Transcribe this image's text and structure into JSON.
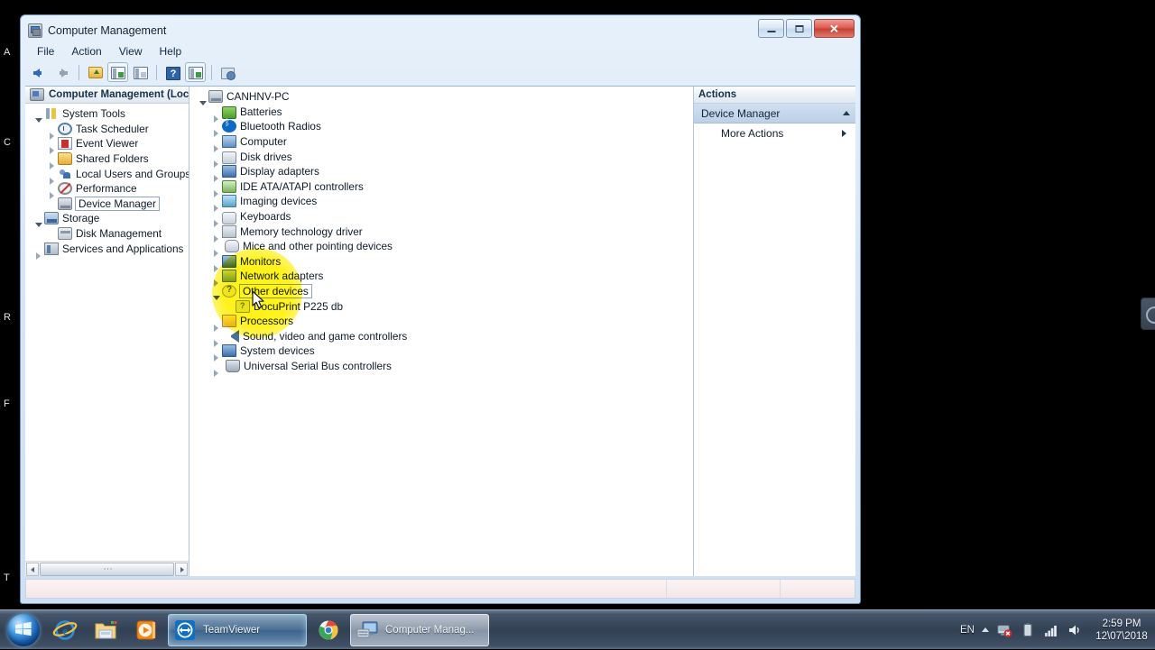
{
  "desktop": {
    "icon_labels": [
      "A",
      "C",
      "R",
      "F",
      "T"
    ],
    "right_widget": "teamviewer-edge-widget"
  },
  "window": {
    "title": "Computer Management",
    "title_icon": "computer-management-icon",
    "buttons": {
      "minimize": "minimize-button",
      "maximize": "maximize-button",
      "close": "close-button",
      "close_glyph": "✕"
    },
    "menus": [
      "File",
      "Action",
      "View",
      "Help"
    ],
    "toolbar": [
      {
        "name": "back-button",
        "icon": "arrow-left-icon"
      },
      {
        "name": "forward-button",
        "icon": "arrow-right-icon"
      },
      {
        "name": "up-one-level-button",
        "icon": "folder-up-icon"
      },
      {
        "name": "show-hide-console-tree-button",
        "icon": "console-tree-icon"
      },
      {
        "name": "properties-button",
        "icon": "properties-icon"
      },
      {
        "name": "help-button",
        "icon": "help-icon",
        "glyph": "?"
      },
      {
        "name": "show-hide-action-pane-button",
        "icon": "action-pane-icon"
      },
      {
        "name": "scan-for-hardware-changes-button",
        "icon": "scan-hardware-icon"
      }
    ]
  },
  "tree_pane": {
    "header": "Computer Management (Local",
    "header_icon": "computer-management-icon",
    "items": [
      {
        "label": "System Tools",
        "indent": 0,
        "expander": "open",
        "icon": "system-tools-icon",
        "icon_class": "ic-tools",
        "selected": false
      },
      {
        "label": "Task Scheduler",
        "indent": 1,
        "expander": "closed",
        "icon": "task-scheduler-icon",
        "icon_class": "ic-clock",
        "selected": false
      },
      {
        "label": "Event Viewer",
        "indent": 1,
        "expander": "closed",
        "icon": "event-viewer-icon",
        "icon_class": "ic-event",
        "selected": false
      },
      {
        "label": "Shared Folders",
        "indent": 1,
        "expander": "closed",
        "icon": "shared-folders-icon",
        "icon_class": "ic-shared",
        "selected": false
      },
      {
        "label": "Local Users and Groups",
        "indent": 1,
        "expander": "closed",
        "icon": "local-users-icon",
        "icon_class": "ic-users",
        "selected": false
      },
      {
        "label": "Performance",
        "indent": 1,
        "expander": "closed",
        "icon": "performance-icon",
        "icon_class": "ic-perf",
        "selected": false
      },
      {
        "label": "Device Manager",
        "indent": 1,
        "expander": "none",
        "icon": "device-manager-icon",
        "icon_class": "ic-devmgr",
        "selected": true
      },
      {
        "label": "Storage",
        "indent": 0,
        "expander": "open",
        "icon": "storage-icon",
        "icon_class": "ic-storage",
        "selected": false
      },
      {
        "label": "Disk Management",
        "indent": 1,
        "expander": "none",
        "icon": "disk-management-icon",
        "icon_class": "ic-disk",
        "selected": false
      },
      {
        "label": "Services and Applications",
        "indent": 0,
        "expander": "closed",
        "icon": "services-apps-icon",
        "icon_class": "ic-services",
        "selected": false
      }
    ],
    "hscroll": {
      "left_arrow": "scroll-left-arrow",
      "right_arrow": "scroll-right-arrow",
      "thumb": "scroll-thumb"
    }
  },
  "detail_pane": {
    "items": [
      {
        "label": "CANHNV-PC",
        "indent": 0,
        "expander": "open",
        "icon": "computer-icon",
        "icon_class": "ic-pc",
        "dim": false,
        "selected": false
      },
      {
        "label": "Batteries",
        "indent": 1,
        "expander": "closed",
        "icon": "batteries-icon",
        "icon_class": "ic-batt",
        "dim": false,
        "selected": false
      },
      {
        "label": "Bluetooth Radios",
        "indent": 1,
        "expander": "closed",
        "icon": "bluetooth-icon",
        "icon_class": "ic-bt",
        "dim": false,
        "selected": false
      },
      {
        "label": "Computer",
        "indent": 1,
        "expander": "closed",
        "icon": "computer-node-icon",
        "icon_class": "ic-comp",
        "dim": false,
        "selected": false
      },
      {
        "label": "Disk drives",
        "indent": 1,
        "expander": "closed",
        "icon": "disk-drives-icon",
        "icon_class": "ic-dd",
        "dim": false,
        "selected": false
      },
      {
        "label": "Display adapters",
        "indent": 1,
        "expander": "closed",
        "icon": "display-adapter-icon",
        "icon_class": "ic-disp",
        "dim": false,
        "selected": false
      },
      {
        "label": "IDE ATA/ATAPI controllers",
        "indent": 1,
        "expander": "closed",
        "icon": "ide-controller-icon",
        "icon_class": "ic-ide",
        "dim": false,
        "selected": false
      },
      {
        "label": "Imaging devices",
        "indent": 1,
        "expander": "closed",
        "icon": "imaging-device-icon",
        "icon_class": "ic-imaging",
        "dim": false,
        "selected": false
      },
      {
        "label": "Keyboards",
        "indent": 1,
        "expander": "closed",
        "icon": "keyboard-icon",
        "icon_class": "ic-kb",
        "dim": false,
        "selected": false
      },
      {
        "label": "Memory technology driver",
        "indent": 1,
        "expander": "closed",
        "icon": "memory-driver-icon",
        "icon_class": "ic-mem",
        "dim": false,
        "selected": false
      },
      {
        "label": "Mice and other pointing devices",
        "indent": 1,
        "expander": "closed",
        "icon": "mouse-icon",
        "icon_class": "ic-mouse",
        "dim": false,
        "selected": false
      },
      {
        "label": "Monitors",
        "indent": 1,
        "expander": "closed",
        "icon": "monitor-icon",
        "icon_class": "ic-mon",
        "dim": false,
        "selected": false
      },
      {
        "label": "Network adapters",
        "indent": 1,
        "expander": "closed",
        "icon": "network-adapter-icon",
        "icon_class": "ic-net",
        "dim": false,
        "selected": false
      },
      {
        "label": "Other devices",
        "indent": 1,
        "expander": "open",
        "icon": "other-devices-icon",
        "icon_class": "ic-other",
        "dim": false,
        "selected": true
      },
      {
        "label": "DocuPrint P225 db",
        "indent": 2,
        "expander": "none",
        "icon": "unknown-device-icon",
        "icon_class": "ic-printerq",
        "dim": false,
        "selected": false
      },
      {
        "label": "Processors",
        "indent": 1,
        "expander": "closed",
        "icon": "processor-icon",
        "icon_class": "ic-proc",
        "dim": false,
        "selected": false
      },
      {
        "label": "Sound, video and game controllers",
        "indent": 1,
        "expander": "closed",
        "icon": "sound-controller-icon",
        "icon_class": "ic-sound",
        "dim": false,
        "selected": false
      },
      {
        "label": "System devices",
        "indent": 1,
        "expander": "closed",
        "icon": "system-devices-icon",
        "icon_class": "ic-sys",
        "dim": false,
        "selected": false
      },
      {
        "label": "Universal Serial Bus controllers",
        "indent": 1,
        "expander": "closed",
        "icon": "usb-controller-icon",
        "icon_class": "ic-usb",
        "dim": false,
        "selected": false
      }
    ]
  },
  "actions_pane": {
    "header": "Actions",
    "group": "Device Manager",
    "group_caret": "collapse-caret-icon",
    "rows": [
      {
        "label": "More Actions",
        "caret": "submenu-caret-icon"
      }
    ]
  },
  "statusbar": {
    "field1": "",
    "field2": "",
    "field3": ""
  },
  "taskbar": {
    "start": "start-orb",
    "pinned": [
      {
        "name": "taskbar-internet-explorer",
        "icon": "internet-explorer-icon"
      },
      {
        "name": "taskbar-windows-explorer",
        "icon": "windows-explorer-icon"
      },
      {
        "name": "taskbar-media-player",
        "icon": "windows-media-player-icon"
      }
    ],
    "windows": [
      {
        "name": "taskbar-teamviewer",
        "label": "TeamViewer",
        "icon": "teamviewer-icon",
        "state": "active"
      },
      {
        "name": "taskbar-chrome",
        "label": "",
        "icon": "chrome-icon",
        "state": "pinned"
      },
      {
        "name": "taskbar-computer-management",
        "label": "Computer Manag...",
        "icon": "computer-management-icon",
        "state": "focused"
      }
    ],
    "tray": {
      "language": "EN",
      "show_hidden": "show-hidden-icons-caret",
      "icons": [
        {
          "name": "network-icon",
          "status": "disconnected"
        },
        {
          "name": "battery-icon",
          "status": "charged"
        },
        {
          "name": "signal-icon",
          "status": "strong"
        },
        {
          "name": "volume-icon",
          "status": "on"
        }
      ],
      "time": "2:59 PM",
      "date": "12\\07\\2018"
    }
  },
  "overlay": {
    "spotlight": "cursor-highlight-spotlight",
    "cursor": "mouse-pointer"
  },
  "colors": {
    "accent": "#2f63a8",
    "highlight": "#fff200",
    "close_red": "#c43f34",
    "selection": "#bcd0e7"
  }
}
